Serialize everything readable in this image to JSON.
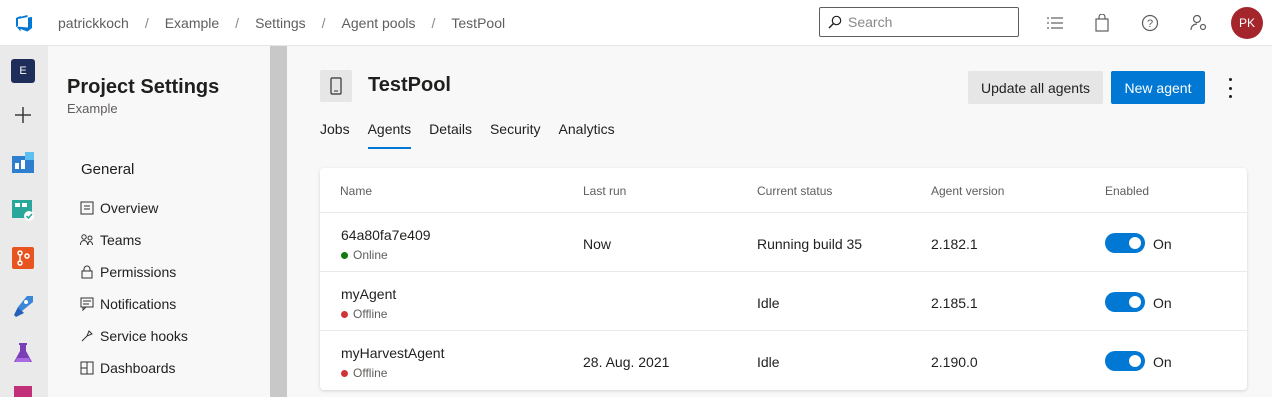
{
  "breadcrumb": [
    "patrickkoch",
    "Example",
    "Settings",
    "Agent pools",
    "TestPool"
  ],
  "search": {
    "placeholder": "Search"
  },
  "user": {
    "initials": "PK",
    "avatar_color": "#a4262c"
  },
  "rail": {
    "org_initial": "E"
  },
  "sidebar": {
    "title": "Project Settings",
    "subtitle": "Example",
    "section": "General",
    "items": [
      "Overview",
      "Teams",
      "Permissions",
      "Notifications",
      "Service hooks",
      "Dashboards"
    ]
  },
  "pool": {
    "title": "TestPool",
    "update_button": "Update all agents",
    "new_button": "New agent",
    "tabs": [
      "Jobs",
      "Agents",
      "Details",
      "Security",
      "Analytics"
    ],
    "active_tab": "Agents"
  },
  "table": {
    "headers": [
      "Name",
      "Last run",
      "Current status",
      "Agent version",
      "Enabled"
    ],
    "rows": [
      {
        "name": "64a80fa7e409",
        "state": "Online",
        "state_color": "#107c10",
        "last_run": "Now",
        "status": "Running build 35",
        "version": "2.182.1",
        "enabled": "On"
      },
      {
        "name": "myAgent",
        "state": "Offline",
        "state_color": "#d13438",
        "last_run": "",
        "status": "Idle",
        "version": "2.185.1",
        "enabled": "On"
      },
      {
        "name": "myHarvestAgent",
        "state": "Offline",
        "state_color": "#d13438",
        "last_run": "28. Aug. 2021",
        "status": "Idle",
        "version": "2.190.0",
        "enabled": "On"
      }
    ]
  },
  "colors": {
    "accent": "#0078d4"
  }
}
